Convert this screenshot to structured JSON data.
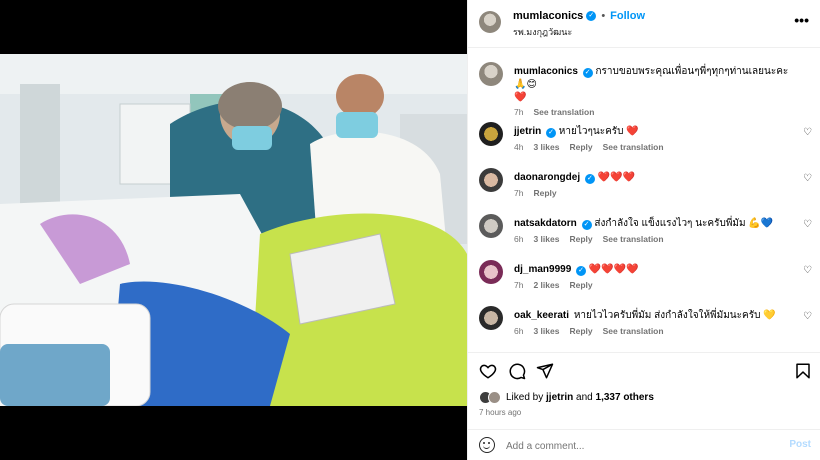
{
  "post": {
    "author": "mumlaconics",
    "follow_label": "Follow",
    "separator": "•",
    "location": "รพ.มงกุฎวัฒนะ",
    "more_label": "•••"
  },
  "caption": {
    "author": "mumlaconics",
    "text": "กราบขอบพระคุณเพื่อนๆพี่ๆทุกๆท่านเลยนะคะ 🙏😊",
    "heart": "❤️",
    "time": "7h",
    "translate": "See translation"
  },
  "comments": [
    {
      "user": "jjetrin",
      "verified": true,
      "text": "หายไวๆนะครับ",
      "hearts": "❤️",
      "time": "4h",
      "likes": "3 likes",
      "reply": "Reply",
      "translate": "See translation"
    },
    {
      "user": "daonarongdej",
      "verified": true,
      "text": "",
      "hearts": "❤️❤️❤️",
      "time": "7h",
      "likes": "",
      "reply": "Reply",
      "translate": ""
    },
    {
      "user": "natsakdatorn",
      "verified": true,
      "text": "ส่งกำลังใจ แข็งแรงไวๆ นะครับพี่มัม 💪💙",
      "hearts": "",
      "time": "6h",
      "likes": "3 likes",
      "reply": "Reply",
      "translate": "See translation"
    },
    {
      "user": "dj_man9999",
      "verified": true,
      "text": "",
      "hearts": "❤️❤️❤️❤️",
      "time": "7h",
      "likes": "2 likes",
      "reply": "Reply",
      "translate": ""
    },
    {
      "user": "oak_keerati",
      "verified": false,
      "text": "หายไวไวครับพี่มัม ส่งกำลังใจให้พี่มัมนะครับ 💛",
      "hearts": "",
      "time": "6h",
      "likes": "3 likes",
      "reply": "Reply",
      "translate": "See translation"
    }
  ],
  "likes": {
    "prefix": "Liked by",
    "user": "jjetrin",
    "conj": "and",
    "others": "1,337 others",
    "ago": "7 hours ago"
  },
  "add_comment": {
    "placeholder": "Add a comment...",
    "post_label": "Post"
  },
  "icons": {
    "like": "heart-icon",
    "comment": "comment-icon",
    "share": "send-icon",
    "save": "bookmark-icon",
    "verified": "verified-badge-icon"
  },
  "colors": {
    "accent": "#0095f6",
    "muted": "#737373",
    "heart": "#ed1c3c"
  }
}
